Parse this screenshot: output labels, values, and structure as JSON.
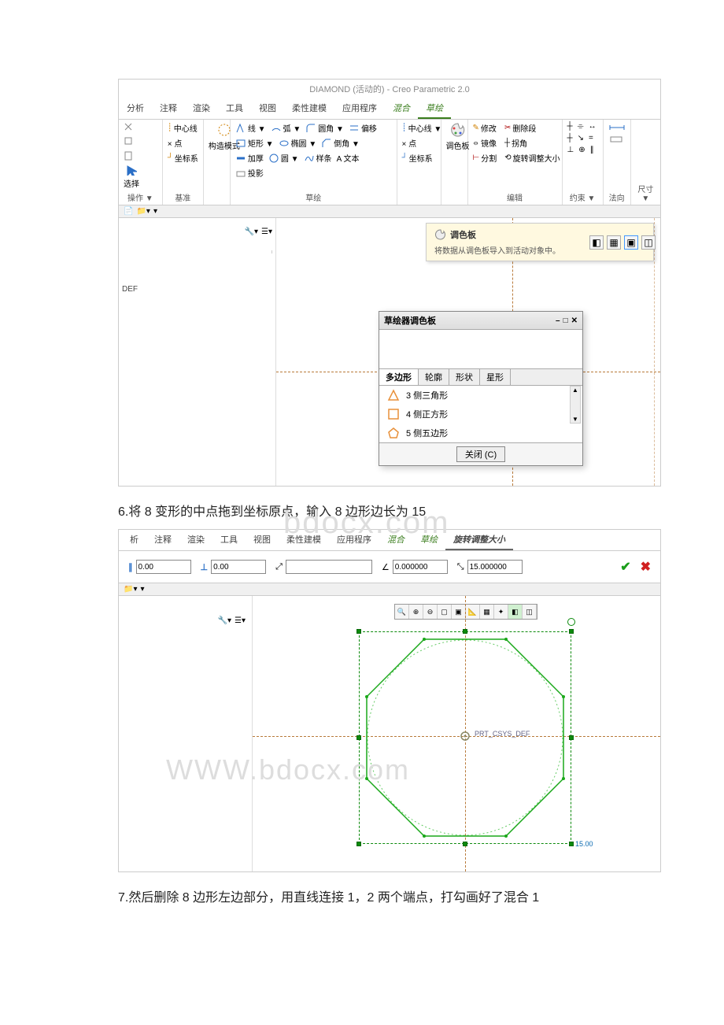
{
  "doc": {
    "step6": "6.将 8 变形的中点拖到坐标原点，输入 8 边形边长为 15",
    "step7": "7.然后删除 8 边形左边部分，用直线连接 1，2 两个端点，打勾画好了混合 1",
    "watermark_top": "bdocx.com",
    "watermark_bottom": "WWW.bdocx.com"
  },
  "shot1": {
    "title": "DIAMOND (活动的) - Creo Parametric 2.0",
    "tabs": [
      "分析",
      "注释",
      "渲染",
      "工具",
      "视图",
      "柔性建模",
      "应用程序",
      "混合",
      "草绘"
    ],
    "tabs_active_index": 8,
    "tabs_green_index": 7,
    "ribbon_groups": {
      "g1_label": "操作 ▼",
      "g1_items": [
        "",
        "",
        "",
        "选择"
      ],
      "g2_label": "基准",
      "g2_items": [
        "中心线",
        "× 点",
        "坐标系"
      ],
      "g3_items": [
        "构造模式"
      ],
      "g4_label": "草绘",
      "g4_lines": "线 ▼",
      "g4_rect": "矩形 ▼",
      "g4_circle": "圆 ▼",
      "g4_arc": "弧 ▼",
      "g4_ellipse": "椭圆 ▼",
      "g4_spline": "样条",
      "g4_fillet": "圆角 ▼",
      "g4_chamfer": "倒角 ▼",
      "g4_text": "A 文本",
      "g4_offset": "偏移",
      "g4_thicken": "加厚",
      "g4_project": "投影",
      "g5_items": [
        "中心线 ▼",
        "× 点",
        "坐标系"
      ],
      "g6_label": "调色板",
      "g7_label": "编辑",
      "g7_modify": "修改",
      "g7_delseg": "删除段",
      "g7_mirror": "镜像",
      "g7_corner": "拐角",
      "g7_divide": "分割",
      "g7_rotate": "旋转调整大小",
      "g8_label": "约束 ▼",
      "g9_label": "法向",
      "g10_label": "尺寸 ▼"
    },
    "tooltip": {
      "title": "调色板",
      "desc": "将数据从调色板导入到活动对象中。"
    },
    "tree": {
      "def": "DEF"
    },
    "palette": {
      "title": "草绘器调色板",
      "tabs": [
        "多边形",
        "轮廓",
        "形状",
        "星形"
      ],
      "items": [
        {
          "sides": 3,
          "label": "3 侧三角形"
        },
        {
          "sides": 4,
          "label": "4 侧正方形"
        },
        {
          "sides": 5,
          "label": "5 侧五边形"
        }
      ],
      "close": "关闭 (C)"
    }
  },
  "shot2": {
    "tabs": [
      "析",
      "注释",
      "渲染",
      "工具",
      "视图",
      "柔性建模",
      "应用程序",
      "混合",
      "草绘",
      "旋转调整大小"
    ],
    "tabs_green_indexes": [
      7,
      8
    ],
    "tabs_active_index": 9,
    "fields": {
      "parallel": "0.00",
      "perp": "0.00",
      "angle": "",
      "scale": "0.000000",
      "side": "15.000000"
    },
    "origin_label": "PRT_CSYS_DEF",
    "dim_label": "15.00"
  },
  "chart_data": {
    "type": "diagram",
    "shape": "regular-octagon",
    "center": "coordinate origin",
    "side_length": 15,
    "bounding_square_side": 15,
    "inscribed_circle": true
  }
}
